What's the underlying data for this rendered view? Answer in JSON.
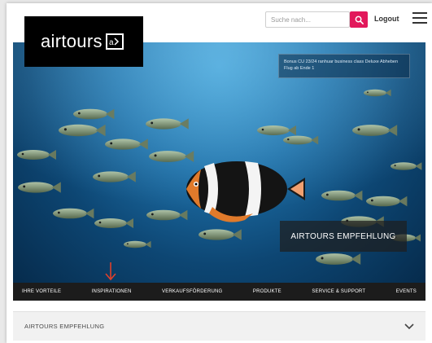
{
  "header": {
    "search_placeholder": "Suche nach...",
    "search_icon": "search-icon",
    "logout_label": "Logout",
    "menu_icon": "hamburger-menu-icon"
  },
  "logo": {
    "text": "airtours",
    "mark_icon": "a-arrow-logo-icon"
  },
  "hero": {
    "notice_text": "Bonus CU 23/24 ranhuar business class Deluxe Abheben Flug ab Ende 1",
    "recommend_label": "AIRTOURS EMPFEHLUNG",
    "image": "school-of-fish-with-clownfish-underwater"
  },
  "nav": {
    "items": [
      "IHRE VORTEILE",
      "INSPIRATIONEN",
      "VERKAUFSFÖRDERUNG",
      "PRODUKTE",
      "SERVICE & SUPPORT",
      "EVENTS"
    ],
    "marker_icon": "red-down-arrow-icon"
  },
  "accordion": {
    "label": "AIRTOURS EMPFEHLUNG",
    "chevron_icon": "chevron-down-icon"
  },
  "colors": {
    "accent": "#e2185b",
    "nav_bg": "#1c1c1c",
    "marker": "#e0402a"
  }
}
